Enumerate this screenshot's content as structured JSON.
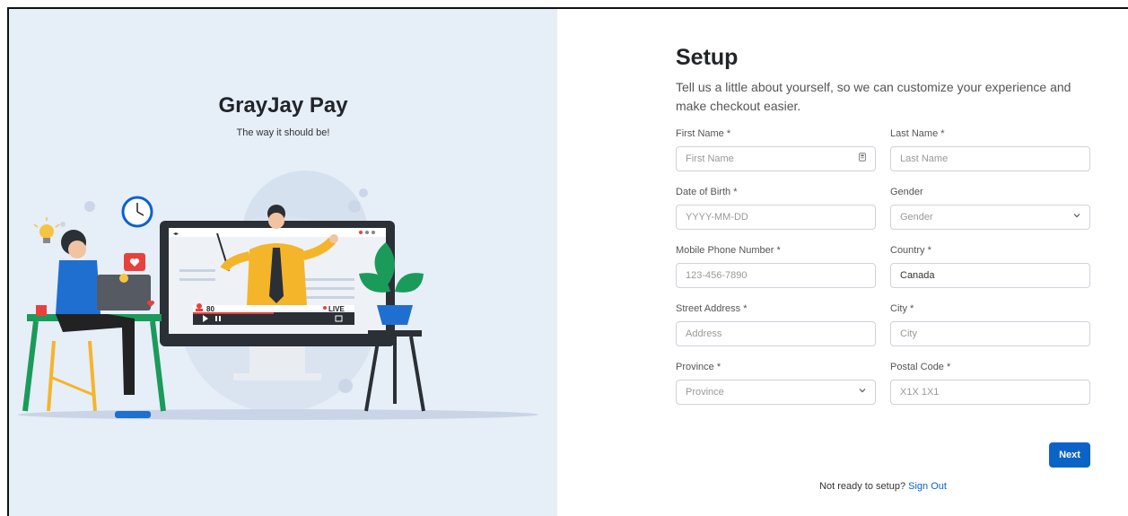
{
  "brand": {
    "name": "GrayJay Pay",
    "tagline": "The way it should be!"
  },
  "illustration": {
    "viewer_count": "80",
    "live_badge": "LIVE"
  },
  "form": {
    "title": "Setup",
    "subtitle": "Tell us a little about yourself, so we can customize your experience and make checkout easier.",
    "fields": {
      "first_name": {
        "label": "First Name *",
        "placeholder": "First Name",
        "value": ""
      },
      "last_name": {
        "label": "Last Name *",
        "placeholder": "Last Name",
        "value": ""
      },
      "dob": {
        "label": "Date of Birth *",
        "placeholder": "YYYY-MM-DD",
        "value": ""
      },
      "gender": {
        "label": "Gender",
        "placeholder": "Gender",
        "value": ""
      },
      "mobile": {
        "label": "Mobile Phone Number *",
        "placeholder": "123-456-7890",
        "value": ""
      },
      "country": {
        "label": "Country *",
        "placeholder": "",
        "value": "Canada"
      },
      "street": {
        "label": "Street Address *",
        "placeholder": "Address",
        "value": ""
      },
      "city": {
        "label": "City *",
        "placeholder": "City",
        "value": ""
      },
      "province": {
        "label": "Province *",
        "placeholder": "Province",
        "value": ""
      },
      "postal": {
        "label": "Postal Code *",
        "placeholder": "X1X 1X1",
        "value": ""
      }
    },
    "next_label": "Next",
    "footer_prefix": "Not ready to setup?",
    "signout_label": "Sign Out"
  },
  "colors": {
    "accent": "#0b63c8",
    "left_panel_bg": "#e6eef8",
    "shirt": "#f5b52a",
    "desk": "#1a9b5a"
  },
  "icons": {
    "first_name_trail": "contact-card-icon",
    "select_chevron": "chevron-down-icon"
  }
}
